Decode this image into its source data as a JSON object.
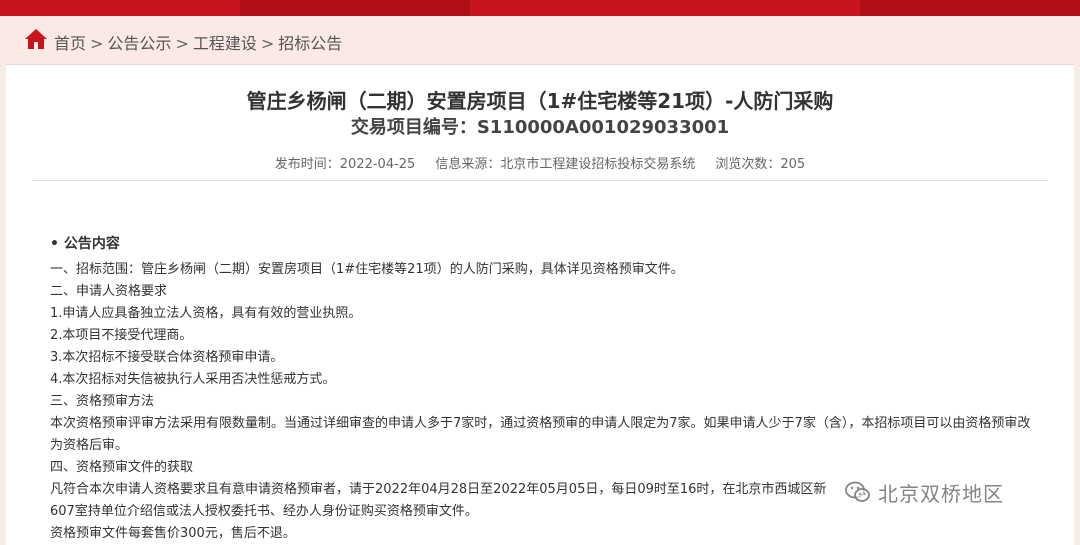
{
  "breadcrumb": {
    "items": [
      "首页",
      "公告公示",
      "工程建设",
      "招标公告"
    ],
    "separator": ">"
  },
  "notice": {
    "title": "管庄乡杨闸（二期）安置房项目（1#住宅楼等21项）-人防门采购",
    "project_number": "交易项目编号：S110000A001029033001",
    "publish_time_label": "发布时间：",
    "publish_time": "2022-04-25",
    "source_label": "信息来源：",
    "source": "北京市工程建设招标投标交易系统",
    "views_label": "浏览次数：",
    "views": "205"
  },
  "content": {
    "section_title": "• 公告内容",
    "lines": [
      "一、招标范围：管庄乡杨闸（二期）安置房项目（1#住宅楼等21项）的人防门采购，具体详见资格预审文件。",
      "二、申请人资格要求",
      "1.申请人应具备独立法人资格，具有有效的营业执照。",
      "2.本项目不接受代理商。",
      "3.本次招标不接受联合体资格预审申请。",
      "4.本次招标对失信被执行人采用否决性惩戒方式。",
      "三、资格预审方法",
      "本次资格预审评审方法采用有限数量制。当通过详细审查的申请人多于7家时，通过资格预审的申请人限定为7家。如果申请人少于7家（含），本招标项目可以由资格预审改为资格后审。",
      "四、资格预审文件的获取",
      "凡符合本次申请人资格要求且有意申请资格预审者，请于2022年04月28日至2022年05月05日，每日09时至16时，在北京市西城区新",
      "607室持单位介绍信或法人授权委托书、经办人身份证购买资格预审文件。",
      "资格预审文件每套售价300元，售后不退。"
    ]
  },
  "watermark": {
    "text": "北京双桥地区",
    "icon": "wechat-icon"
  },
  "colors": {
    "brand_red": "#c8151d",
    "crumb_bg": "#fbe9e5"
  }
}
